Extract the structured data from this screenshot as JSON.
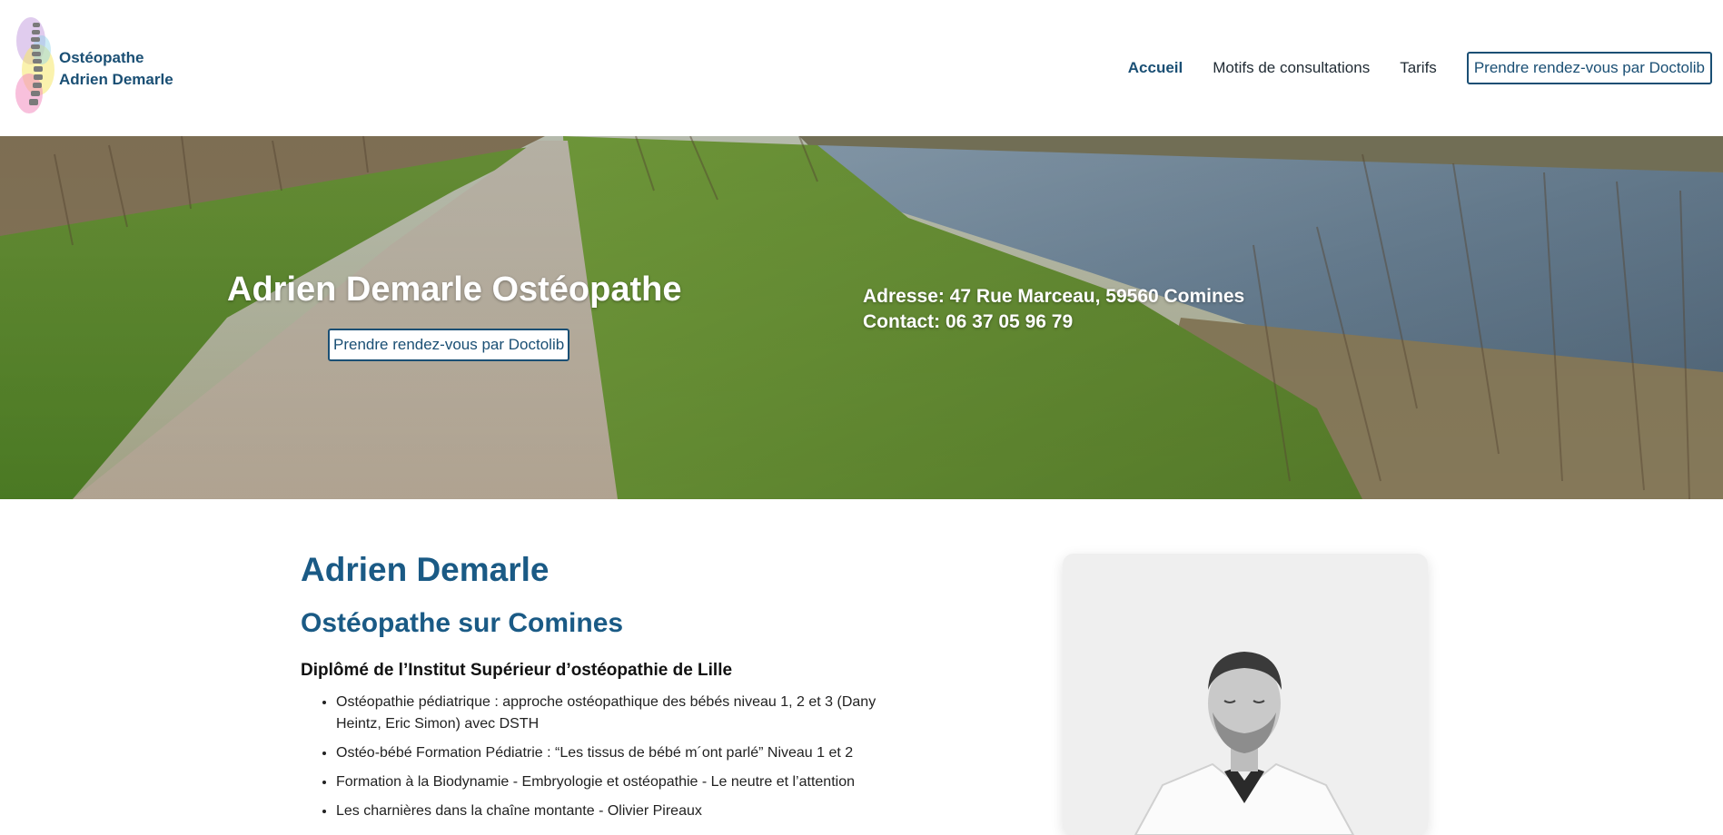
{
  "header": {
    "brand_line1": "Ostéopathe",
    "brand_line2": "Adrien Demarle",
    "nav": {
      "home": "Accueil",
      "reasons": "Motifs de consultations",
      "prices": "Tarifs",
      "booking": "Prendre rendez-vous par Doctolib"
    }
  },
  "hero": {
    "title": "Adrien Demarle Ostéopathe",
    "button": "Prendre rendez-vous par Doctolib",
    "address": "Adresse: 47 Rue Marceau, 59560 Comines",
    "contact": "Contact: 06 37 05 96 79"
  },
  "main": {
    "name": "Adrien Demarle",
    "subtitle": "Ostéopathe sur Comines",
    "diploma": "Diplômé de l’Institut Supérieur d’ostéopathie de Lille",
    "trainings": [
      "Ostéopathie pédiatrique : approche ostéopathique des bébés niveau 1, 2 et 3 (Dany Heintz, Eric Simon) avec DSTH",
      "Ostéo-bébé Formation Pédiatrie : “Les tissus de bébé m´ont parlé” Niveau 1 et 2",
      "Formation à la Biodynamie - Embryologie et ostéopathie - Le neutre et l’attention",
      "Les charnières dans la chaîne montante - Olivier Pireaux"
    ]
  },
  "colors": {
    "primary": "#1a4f74",
    "heading": "#1a5a85"
  }
}
